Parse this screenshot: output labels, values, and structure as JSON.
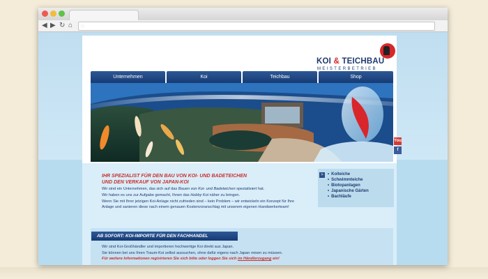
{
  "logo": {
    "brand_left": "KOI",
    "brand_amp": "&",
    "brand_right": "TEICHBAU",
    "subtitle": "MEISTERBETRIEB"
  },
  "nav": {
    "items": [
      "Unternehmen",
      "Koi",
      "Teichbau",
      "Shop"
    ]
  },
  "social": {
    "youtube_label": "You",
    "facebook_label": "f"
  },
  "headline": {
    "line1": "IHR SPEZIALIST FÜR DEN BAU VON KOI- UND BADETEICHEN",
    "line2": "UND DEN VERKAUF VON JAPAN-KOI"
  },
  "intro": {
    "p1_a": "Wir sind ein Unternehmen, das sich auf das ",
    "p1_em1": "Bauen von Koi- und Badeteichen",
    "p1_b": " spezialisiert hat.",
    "p2_a": "Wir haben es uns zur Aufgabe gemacht, Ihnen das ",
    "p2_em": "Hobby Koi",
    "p2_b": " näher zu bringen.",
    "p3": "Wenn Sie mit Ihrer jetzigen Koi-Anlage nicht zufrieden sind – kein Problem – wir entwickeln ein Konzept für Ihre Anlage und sanieren diese nach einem genauen Kostenvoranschlag mit unserem eigenen Handwerkerteam!"
  },
  "sidebar": {
    "arrow": ">",
    "items": [
      "Koiteiche",
      "Schwimmteiche",
      "Biotopanlagen",
      "Japanische Gärten",
      "Bachläufe"
    ]
  },
  "news": {
    "header": "AB SOFORT: KOI-IMPORTE FÜR DEN FACHHANDEL",
    "line1": "Wir sind Koi-Großhändler und importieren hochwertige Koi direkt aus Japan.",
    "line2": "Sie können bei uns Ihren Traum-Koi selbst aussuchen, ohne dafür eigens nach Japan reisen zu müssen.",
    "note_a": "Für weitere Informationen registrieren Sie sich bitte oder loggen Sie sich ",
    "note_link": "im Händlerzugang",
    "note_b": " ein!"
  },
  "browser_controls": {
    "back": "◀",
    "forward": "▶",
    "reload": "↻",
    "home": "⌂",
    "site_icon": "◌"
  },
  "colors": {
    "brand_blue": "#1f3a6f",
    "nav_blue": "#163b74",
    "accent_red": "#c8302f",
    "page_bg": "#c5e2f2"
  }
}
